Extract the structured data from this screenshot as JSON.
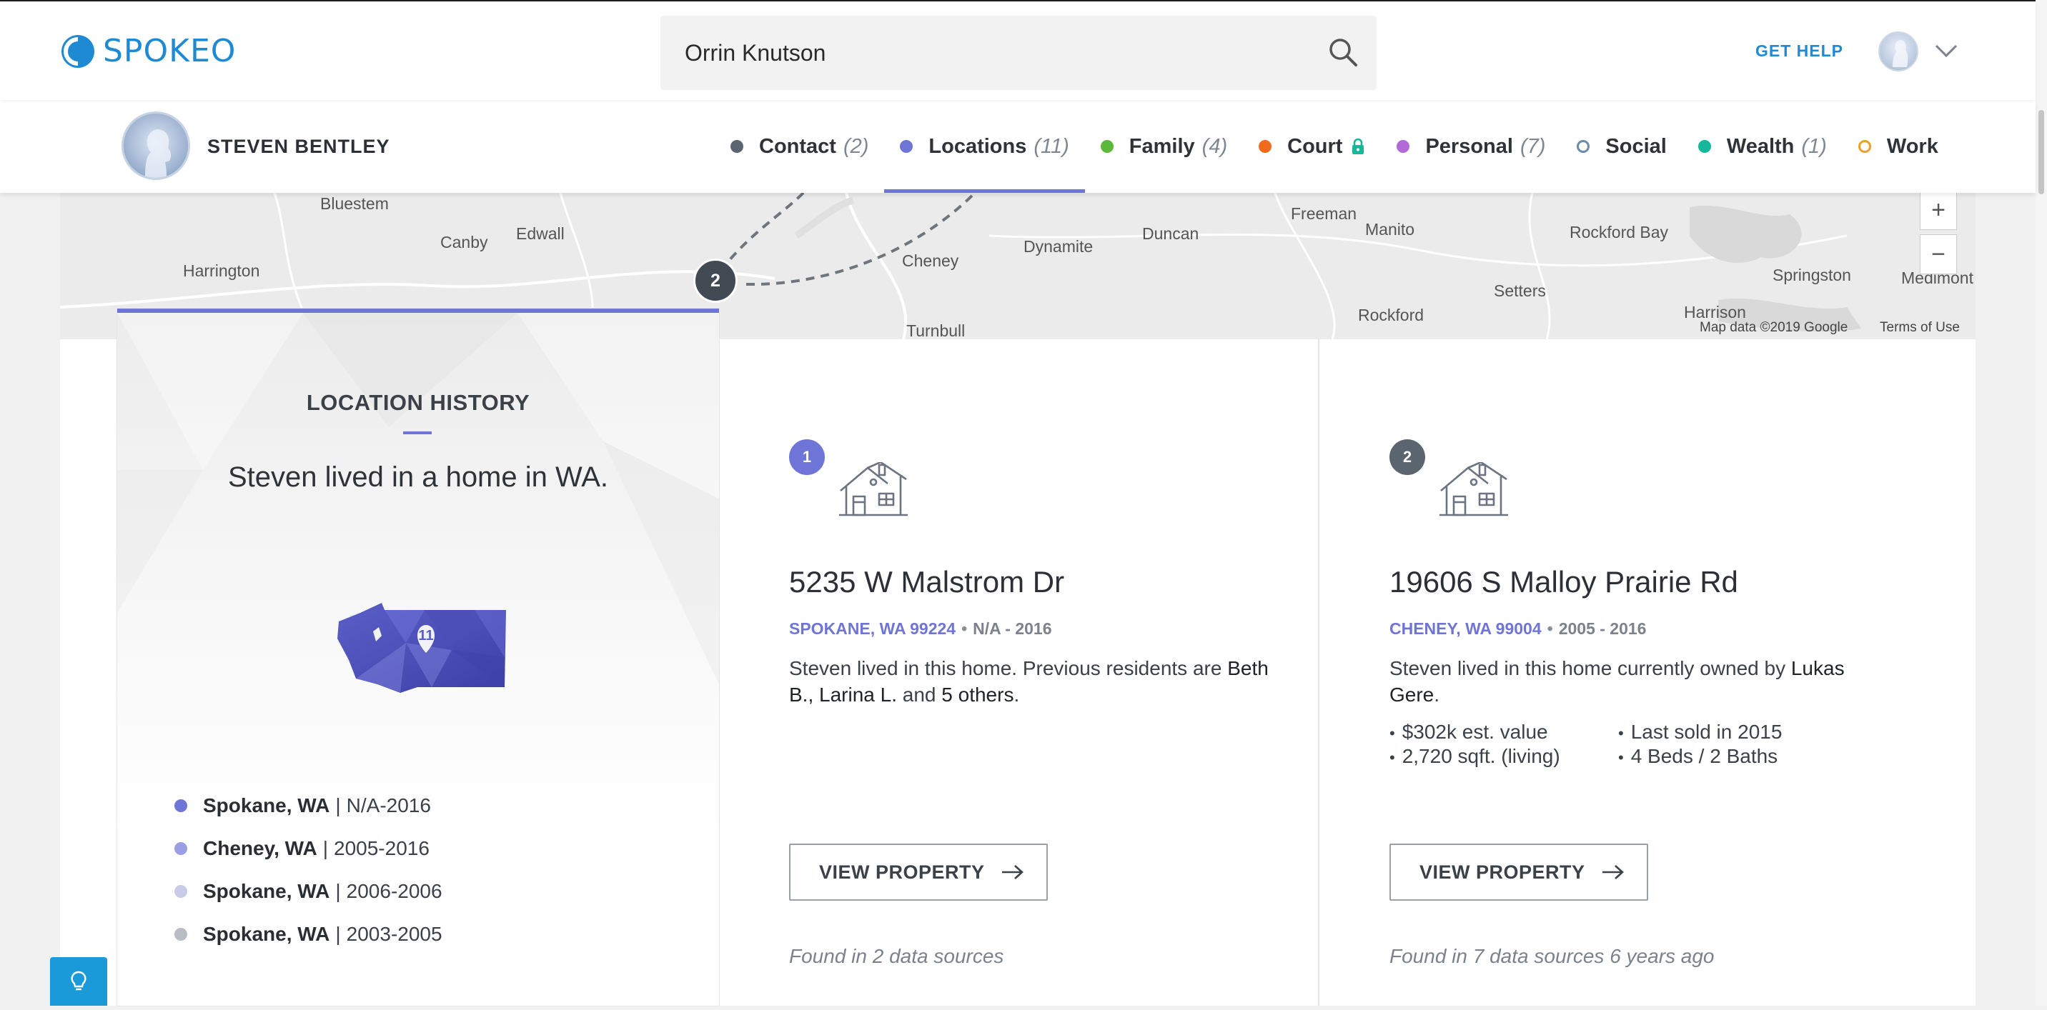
{
  "header": {
    "logo_text": "SPOKEO",
    "search_value": "Orrin Knutson",
    "get_help": "GET HELP",
    "accent_color": "#1f8ad4"
  },
  "profile": {
    "name": "STEVEN BENTLEY"
  },
  "tabs": [
    {
      "label": "Contact",
      "count": "(2)",
      "color": "#5b6570",
      "active": false
    },
    {
      "label": "Locations",
      "count": "(11)",
      "color": "#6f75d6",
      "active": true
    },
    {
      "label": "Family",
      "count": "(4)",
      "color": "#5cb83a",
      "active": false
    },
    {
      "label": "Court",
      "count": "",
      "color": "#f26b1d",
      "active": false,
      "locked": true
    },
    {
      "label": "Personal",
      "count": "(7)",
      "color": "#b06bd9",
      "active": false
    },
    {
      "label": "Social",
      "count": "",
      "color": "#6b8ba8",
      "active": false,
      "hollow": true
    },
    {
      "label": "Wealth",
      "count": "(1)",
      "color": "#16b79a",
      "active": false
    },
    {
      "label": "Work",
      "count": "",
      "color": "#f0a020",
      "active": false,
      "hollow": true
    }
  ],
  "map": {
    "labels": [
      "Bluestem",
      "Canby",
      "Edwall",
      "Harrington",
      "Cheney",
      "Dynamite",
      "Duncan",
      "Freeman",
      "Manito",
      "Rockford Bay",
      "Springston",
      "Medimont",
      "Setters",
      "Rockford",
      "Harrison",
      "Turnbull"
    ],
    "marker": "2",
    "attribution": "Map data ©2019 Google",
    "terms": "Terms of Use",
    "zoom_in": "+",
    "zoom_out": "−"
  },
  "history": {
    "title": "LOCATION HISTORY",
    "summary": "Steven lived in a home in WA.",
    "map_count": "11",
    "locations": [
      {
        "city": "Spokane, WA",
        "years": "N/A-2016",
        "color": "#6f75d6"
      },
      {
        "city": "Cheney, WA",
        "years": "2005-2016",
        "color": "#9a9fe4"
      },
      {
        "city": "Spokane, WA",
        "years": "2006-2006",
        "color": "#c9cbe9"
      },
      {
        "city": "Spokane, WA",
        "years": "2003-2005",
        "color": "#b9bcc2"
      }
    ]
  },
  "properties": [
    {
      "number": "1",
      "number_color": "#6f75d6",
      "address": "5235 W Malstrom Dr",
      "city": "SPOKANE, WA 99224",
      "years": "N/A - 2016",
      "desc_prefix": "Steven lived in this home. Previous residents are",
      "desc_names": "Beth B., Larina L.",
      "desc_and": "and",
      "desc_others": "5 others",
      "desc_end": ".",
      "button": "VIEW PROPERTY",
      "found": "Found in 2 data sources"
    },
    {
      "number": "2",
      "number_color": "#5b6570",
      "address": "19606 S Malloy Prairie Rd",
      "city": "CHENEY, WA 99004",
      "years": "2005 - 2016",
      "desc_prefix": "Steven lived in this home currently owned by",
      "desc_owner": "Lukas Gere",
      "desc_end": ".",
      "facts": [
        "$302k est. value",
        "Last sold in 2015",
        "2,720 sqft. (living)",
        "4 Beds / 2 Baths"
      ],
      "button": "VIEW PROPERTY",
      "found": "Found in 7 data sources 6 years ago"
    }
  ]
}
